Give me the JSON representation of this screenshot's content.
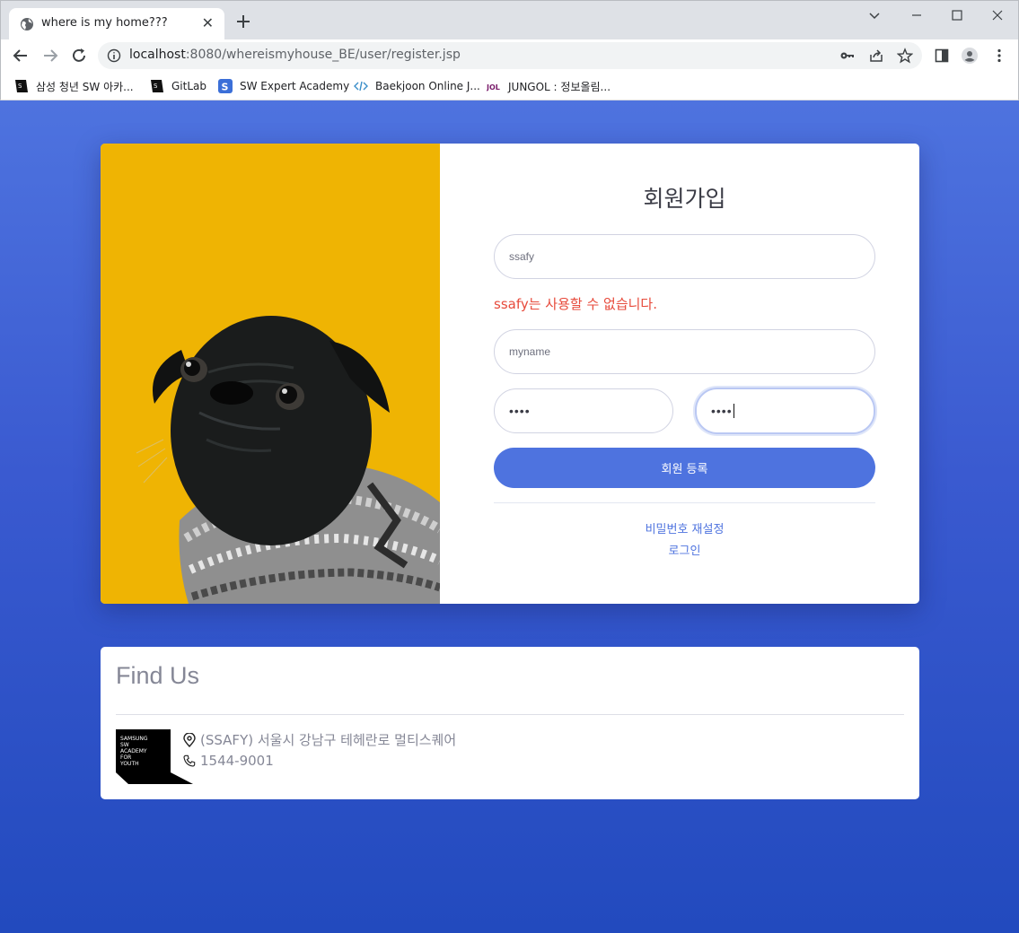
{
  "browser": {
    "tab_title": "where is my home???",
    "url_host": "localhost",
    "url_path": ":8080/whereismyhouse_BE/user/register.jsp",
    "bookmarks": [
      {
        "label": "삼성 청년 SW 아카..."
      },
      {
        "label": "GitLab"
      },
      {
        "label": "SW Expert Academy"
      },
      {
        "label": "Baekjoon Online J..."
      },
      {
        "label": "JUNGOL : 정보올림..."
      }
    ]
  },
  "register": {
    "title": "회원가입",
    "id_value": "ssafy",
    "id_error": "ssafy는 사용할 수 없습니다.",
    "name_value": "myname",
    "password_masked": "••••",
    "password_confirm_masked": "••••",
    "submit_label": "회원 등록",
    "reset_password_link": "비밀번호 재설정",
    "login_link": "로그인"
  },
  "find_us": {
    "title": "Find Us",
    "logo_text": "SAMSUNG SW ACADEMY FOR YOUTH",
    "address": "(SSAFY) 서울시 강남구 테헤란로 멀티스퀘어",
    "phone": "1544-9001"
  },
  "colors": {
    "primary": "#4e73df",
    "error": "#e74a3b",
    "image_background": "#efb403"
  }
}
